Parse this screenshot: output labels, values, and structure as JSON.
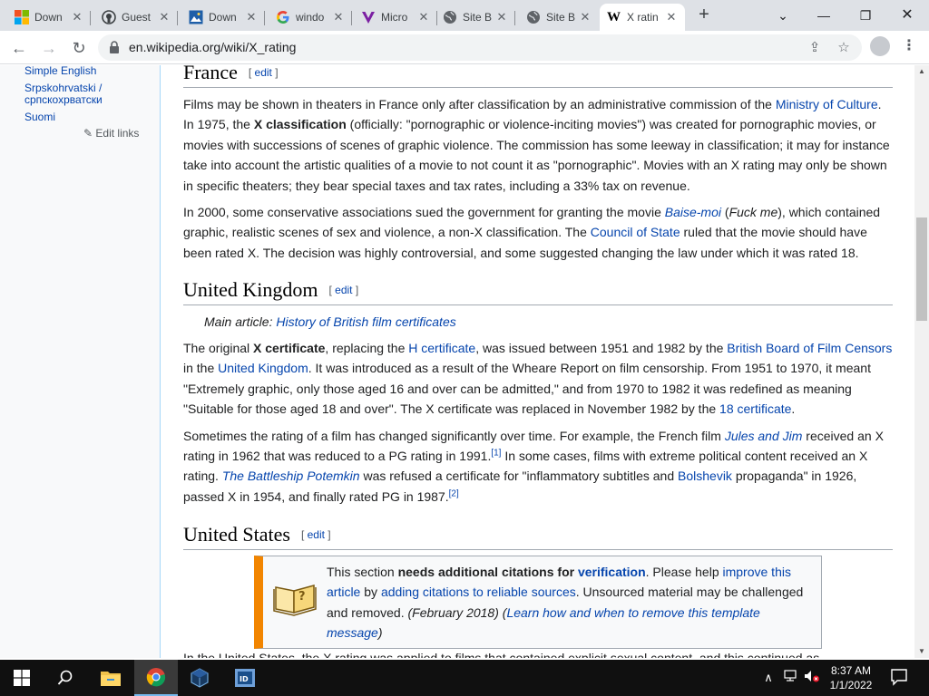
{
  "browser": {
    "tabs": [
      {
        "title": "Down",
        "icon": "windows-logo-icon",
        "active": false
      },
      {
        "title": "Guest",
        "icon": "github-icon",
        "active": false
      },
      {
        "title": "Down",
        "icon": "image-icon",
        "active": false
      },
      {
        "title": "windo",
        "icon": "google-g-icon",
        "active": false
      },
      {
        "title": "Micro",
        "icon": "v-logo-icon",
        "active": false
      },
      {
        "title": "Site B",
        "icon": "globe-icon",
        "active": false
      },
      {
        "title": "Site B",
        "icon": "globe-icon",
        "active": false
      },
      {
        "title": "X ratin",
        "icon": "wikipedia-w-icon",
        "active": true
      }
    ],
    "new_tab": "+",
    "url": "en.wikipedia.org/wiki/X_rating"
  },
  "sidebar": {
    "languages": [
      "Simple English",
      "Srpskohrvatski / српскохрватски",
      "Suomi"
    ],
    "edit_links": "Edit links"
  },
  "article": {
    "edit_label": "edit",
    "france": {
      "heading": "France",
      "p1": {
        "t1": "Films may be shown in theaters in France only after classification by an administrative commission of the ",
        "link_ministry": "Ministry of Culture",
        "t2": ". In 1975, the ",
        "bold": "X classification",
        "t3": " (officially: \"pornographic or violence-inciting movies\") was created for pornographic movies, or movies with successions of scenes of graphic violence. The commission has some leeway in classification; it may for instance take into account the artistic qualities of a movie to not count it as \"pornographic\". Movies with an X rating may only be shown in specific theaters; they bear special taxes and tax rates, including a 33% tax on revenue."
      },
      "p2": {
        "t1": "In 2000, some conservative associations sued the government for granting the movie ",
        "link_baise": "Baise-moi",
        "t2": " (",
        "italic": "Fuck me",
        "t3": "), which contained graphic, realistic scenes of sex and violence, a non-X classification. The ",
        "link_council": "Council of State",
        "t4": " ruled that the movie should have been rated X. The decision was highly controversial, and some suggested changing the law under which it was rated 18."
      }
    },
    "uk": {
      "heading": "United Kingdom",
      "hatnote_prefix": "Main article: ",
      "hatnote_link": "History of British film certificates",
      "p1": {
        "t1": "The original ",
        "bold": "X certificate",
        "t2": ", replacing the ",
        "link_h": "H certificate",
        "t3": ", was issued between 1951 and 1982 by the ",
        "link_bbfc": "British Board of Film Censors",
        "t4": " in the ",
        "link_uk": "United Kingdom",
        "t5": ". It was introduced as a result of the Wheare Report on film censorship. From 1951 to 1970, it meant \"Extremely graphic, only those aged 16 and over can be admitted,\" and from 1970 to 1982 it was redefined as meaning \"Suitable for those aged 18 and over\". The X certificate was replaced in November 1982 by the ",
        "link_18": "18 certificate",
        "t6": "."
      },
      "p2": {
        "t1": "Sometimes the rating of a film has changed significantly over time. For example, the French film ",
        "link_jules": "Jules and Jim",
        "t2": " received an X rating in 1962 that was reduced to a PG rating in 1991.",
        "ref1": "[1]",
        "t3": " In some cases, films with extreme political content received an X rating. ",
        "link_potemkin": "The Battleship Potemkin",
        "t4": " was refused a certificate for \"inflammatory subtitles and ",
        "link_bolshevik": "Bolshevik",
        "t5": " propaganda\" in 1926, passed X in 1954, and finally rated PG in 1987.",
        "ref2": "[2]"
      }
    },
    "us": {
      "heading": "United States",
      "ambox": {
        "t1": "This section ",
        "bold": "needs additional citations for ",
        "bold_link": "verification",
        "t2": ". Please help ",
        "link_improve": "improve this article",
        "t3": " by ",
        "link_adding": "adding citations to reliable sources",
        "t4": ". Unsourced material may be challenged and removed. ",
        "date": "(February 2018)",
        "t5": " (",
        "link_learn": "Learn how and when to remove this template message",
        "t6": ")"
      },
      "cut_line": "In the United States, the X rating was applied to films that contained explicit sexual content, and this continued as"
    }
  },
  "taskbar": {
    "items": [
      "start-icon",
      "search-icon",
      "file-explorer-icon",
      "chrome-icon",
      "virtualbox-icon",
      "cpu-z-icon"
    ],
    "clock_time": "8:37 AM",
    "clock_date": "1/1/2022"
  }
}
